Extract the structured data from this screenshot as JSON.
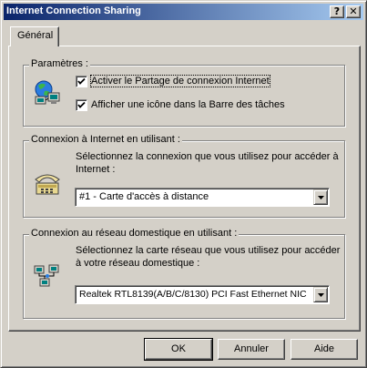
{
  "window": {
    "title": "Internet Connection Sharing",
    "help_glyph": "?",
    "close_glyph": "✕"
  },
  "tabs": [
    {
      "label": "Général",
      "selected": true
    }
  ],
  "params_group": {
    "label": "Paramètres :",
    "icon": "network-sharing-icon",
    "checkboxes": [
      {
        "label": "Activer le Partage de connexion Internet",
        "checked": true,
        "focused": true
      },
      {
        "label": "Afficher une icône dans la Barre des tâches",
        "checked": true,
        "focused": false
      }
    ]
  },
  "internet_group": {
    "label": "Connexion à Internet en utilisant :",
    "icon": "telephone-modem-icon",
    "description_line1": "Sélectionnez la connexion que vous utilisez pour accéder à",
    "description_line2": "Internet :",
    "selected": "#1 - Carte d'accès à distance"
  },
  "home_group": {
    "label": "Connexion au réseau domestique en utilisant :",
    "icon": "home-network-icon",
    "description_line1": "Sélectionnez la carte réseau que vous utilisez pour accéder",
    "description_line2": "à votre réseau domestique :",
    "selected": "Realtek RTL8139(A/B/C/8130) PCI Fast Ethernet NIC"
  },
  "buttons": {
    "ok": "OK",
    "cancel": "Annuler",
    "help": "Aide"
  },
  "colors": {
    "titlebar_start": "#0a246a",
    "titlebar_end": "#a6caf0",
    "face": "#d4d0c8"
  }
}
